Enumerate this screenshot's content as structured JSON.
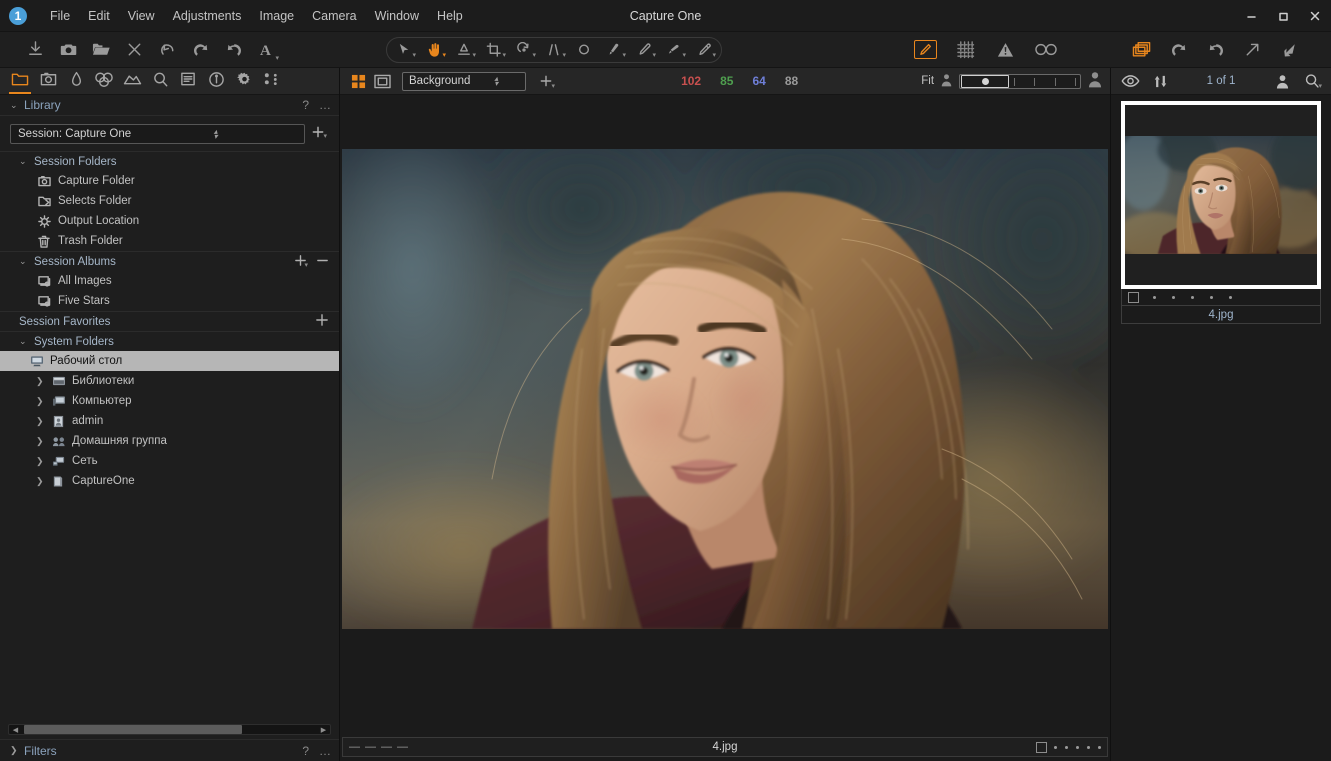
{
  "window": {
    "title": "Capture One",
    "logo_badge": "1",
    "minimize": "–",
    "maximize": "❐",
    "close": "✕"
  },
  "menubar": {
    "items": [
      {
        "label": "File"
      },
      {
        "label": "Edit"
      },
      {
        "label": "View"
      },
      {
        "label": "Adjustments"
      },
      {
        "label": "Image"
      },
      {
        "label": "Camera"
      },
      {
        "label": "Window"
      },
      {
        "label": "Help"
      }
    ]
  },
  "main_toolbar": {
    "left_buttons": [
      {
        "name": "import-images-icon",
        "title": "Import Images"
      },
      {
        "name": "capture-icon",
        "title": "Capture"
      },
      {
        "name": "open-folder-icon",
        "title": "Open"
      },
      {
        "name": "close-x-icon",
        "title": "Close"
      },
      {
        "name": "undo-arrow-icon",
        "title": "Undo"
      },
      {
        "name": "rotate-left-icon",
        "title": "Rotate Left"
      },
      {
        "name": "rotate-right-icon",
        "title": "Rotate Right"
      },
      {
        "name": "text-tool-icon",
        "title": "Annotations"
      }
    ],
    "tool_pill": [
      {
        "name": "pointer-tool-icon",
        "active": false
      },
      {
        "name": "pan-hand-tool-icon",
        "active": true
      },
      {
        "name": "gradient-mask-tool-icon",
        "active": false
      },
      {
        "name": "crop-tool-icon",
        "active": false
      },
      {
        "name": "rotate-tool-icon",
        "active": false
      },
      {
        "name": "keystone-tool-icon",
        "active": false
      },
      {
        "name": "spot-removal-tool-icon",
        "active": false
      },
      {
        "name": "draw-mask-brush-icon",
        "active": false
      },
      {
        "name": "erase-mask-brush-icon",
        "active": false
      },
      {
        "name": "linear-gradient-brush-icon",
        "active": false
      },
      {
        "name": "heal-brush-icon",
        "active": false
      }
    ],
    "right_buttons": [
      {
        "name": "edit-pen-icon",
        "active": true
      },
      {
        "name": "grid-overlay-icon",
        "active": false
      },
      {
        "name": "exposure-warning-icon",
        "active": false
      },
      {
        "name": "focus-mask-icon",
        "active": false
      }
    ],
    "far_right_buttons": [
      {
        "name": "copy-layers-icon",
        "active": true
      },
      {
        "name": "rotate-counterclockwise-icon",
        "active": false
      },
      {
        "name": "rotate-clockwise-icon",
        "active": false
      },
      {
        "name": "export-arrow-icon",
        "active": false
      },
      {
        "name": "import-arrow-icon",
        "active": false
      }
    ]
  },
  "tool_tabs": [
    {
      "name": "tab-library",
      "icon": "folder-icon",
      "active": true
    },
    {
      "name": "tab-capture",
      "icon": "camera-icon",
      "active": false
    },
    {
      "name": "tab-lens",
      "icon": "lens-icon",
      "active": false
    },
    {
      "name": "tab-color",
      "icon": "color-circles-icon",
      "active": false
    },
    {
      "name": "tab-exposure",
      "icon": "exposure-icon",
      "active": false
    },
    {
      "name": "tab-details",
      "icon": "magnifier-icon",
      "active": false
    },
    {
      "name": "tab-adjustments",
      "icon": "list-icon",
      "active": false
    },
    {
      "name": "tab-metadata",
      "icon": "info-icon",
      "active": false
    },
    {
      "name": "tab-output",
      "icon": "gear-icon",
      "active": false
    },
    {
      "name": "tab-batch",
      "icon": "batch-icon",
      "active": false
    }
  ],
  "library": {
    "panel_title": "Library",
    "help_icon": "?",
    "menu_icon": "…",
    "session_value": "Session: Capture One",
    "add_label": "+",
    "groups": [
      {
        "label": "Session Folders",
        "actions": [],
        "items": [
          {
            "label": "Capture Folder",
            "icon": "capture-folder-icon"
          },
          {
            "label": "Selects Folder",
            "icon": "selects-folder-icon"
          },
          {
            "label": "Output Location",
            "icon": "output-gear-icon"
          },
          {
            "label": "Trash Folder",
            "icon": "trash-icon"
          }
        ]
      },
      {
        "label": "Session Albums",
        "actions": [
          "+",
          "–"
        ],
        "items": [
          {
            "label": "All Images",
            "icon": "album-icon"
          },
          {
            "label": "Five Stars",
            "icon": "album-icon"
          }
        ]
      },
      {
        "label": "Session Favorites",
        "actions": [
          "+"
        ],
        "items": []
      }
    ],
    "system_folders": {
      "label": "System Folders",
      "items": [
        {
          "label": "Рабочий стол",
          "icon": "desktop-icon",
          "selected": true,
          "twisty": false
        },
        {
          "label": "Библиотеки",
          "icon": "libraries-icon",
          "selected": false,
          "twisty": true
        },
        {
          "label": "Компьютер",
          "icon": "computer-icon",
          "selected": false,
          "twisty": true
        },
        {
          "label": "admin",
          "icon": "user-folder-icon",
          "selected": false,
          "twisty": true
        },
        {
          "label": "Домашняя группа",
          "icon": "homegroup-icon",
          "selected": false,
          "twisty": true
        },
        {
          "label": "Сеть",
          "icon": "network-icon",
          "selected": false,
          "twisty": true
        },
        {
          "label": "CaptureOne",
          "icon": "drive-icon",
          "selected": false,
          "twisty": true
        }
      ]
    }
  },
  "filters": {
    "label": "Filters",
    "help_icon": "?",
    "menu_icon": "…"
  },
  "viewer_toolbar": {
    "grid_view_icon": "grid-view-icon",
    "single_view_icon": "single-view-icon",
    "background_value": "Background",
    "add_label": "+",
    "readout": {
      "r": "102",
      "g": "85",
      "b": "64",
      "l": "88",
      "r_color": "#c8504f",
      "g_color": "#4f9f4f",
      "b_color": "#6f7fd8",
      "l_color": "#9a9a9a"
    },
    "fit_label": "Fit",
    "zoom_min_icon": "person-small-icon",
    "zoom_max_icon": "person-large-icon"
  },
  "viewer_footer": {
    "dashes": [
      "—",
      "—",
      "—",
      "—"
    ],
    "filename": "4.jpg",
    "color_tag": "none",
    "star_count": 5
  },
  "browser_toolbar": {
    "view_toggle_icon": "eye-icon",
    "sort_icon": "sort-updown-icon",
    "counter": "1 of 1",
    "size_icon": "person-icon",
    "search_icon": "search-icon"
  },
  "browser": {
    "thumbnails": [
      {
        "filename": "4.jpg",
        "selected": true,
        "star_count": 5,
        "color_tag": "none"
      }
    ]
  },
  "colors": {
    "accent": "#e8861d",
    "panel_bg": "#1e1e1e",
    "toolbar_bg": "#262626",
    "viewer_bg": "#1b1b1b",
    "text": "#c2c2c2",
    "link_text": "#8ba3bd",
    "selection_bg": "#b6b6b6"
  }
}
